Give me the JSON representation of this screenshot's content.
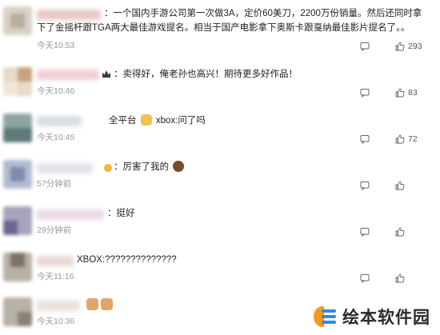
{
  "comments": [
    {
      "text": "：一个国内手游公司第一次做3A，定价60美刀，2200万份销量。然后还同时拿下了金摇杆跟TGA两大最佳游戏提名。相当于国产电影拿下奥斯卡跟戛纳最佳影片提名了。。",
      "time": "今天10:53",
      "like_count": "293",
      "reply_count": ""
    },
    {
      "text": "：卖得好，俺老孙也高兴！期待更多好作品！",
      "time": "今天10:46",
      "like_count": "83",
      "reply_count": ""
    },
    {
      "text_pre": "全平台",
      "text_post": "xbox:问了吗",
      "time": "今天10:45",
      "like_count": "72",
      "reply_count": ""
    },
    {
      "text": "：厉害了我的",
      "time": "57分钟前",
      "like_count": "",
      "reply_count": ""
    },
    {
      "text": "：挺好",
      "time": "29分钟前",
      "like_count": "",
      "reply_count": ""
    },
    {
      "text": "XBOX:??????????????",
      "time": "今天11:16",
      "like_count": "",
      "reply_count": ""
    },
    {
      "text": "",
      "time": "今天10:36",
      "like_count": "",
      "reply_count": ""
    }
  ],
  "watermark": {
    "text": "绘本软件园"
  },
  "colors": {
    "time": "#999999",
    "text": "#222222",
    "watermark_orange": "#f39a1e",
    "watermark_blue": "#2b8be6"
  }
}
